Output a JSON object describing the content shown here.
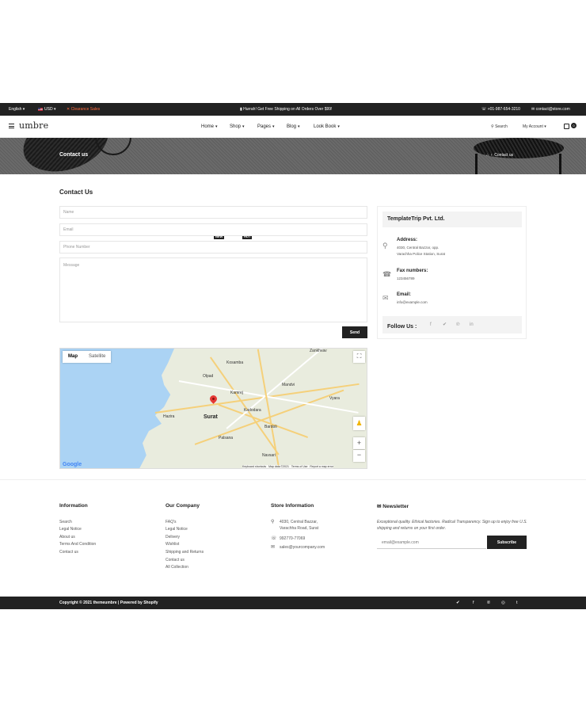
{
  "topbar": {
    "language": "English",
    "currency": "USD",
    "clearance": "Clearance Sales",
    "shipping_msg": "Hurrah! Get Free Shipping on All Orders Over $99!",
    "phone": "+01-987-654-3210",
    "email": "contact@store.com"
  },
  "header": {
    "logo": "umbre",
    "nav": [
      {
        "label": "Home",
        "badge": "NEW"
      },
      {
        "label": "Shop",
        "badge": "HOT"
      },
      {
        "label": "Pages",
        "badge": ""
      },
      {
        "label": "Blog",
        "badge": ""
      },
      {
        "label": "Look Book",
        "badge": ""
      }
    ],
    "search_label": "Search",
    "account_label": "My Account",
    "cart_count": "0"
  },
  "banner": {
    "title": "Contact us",
    "breadcrumb_current": "Contact us"
  },
  "contact_form": {
    "heading": "Contact Us",
    "name_placeholder": "Name",
    "email_placeholder": "Email",
    "phone_placeholder": "Phone Number",
    "message_placeholder": "Message",
    "send_label": "Send"
  },
  "info_card": {
    "company": "TemplateTrip Pvt. Ltd.",
    "address_label": "Address:",
    "address_line1": "4030, Central Bazzar, opp.",
    "address_line2": "Varachha Police Station, Surat",
    "fax_label": "Fax numbers:",
    "fax_value": "123456789",
    "email_label": "Email:",
    "email_value": "info@example.com",
    "follow_label": "Follow Us :"
  },
  "map": {
    "tab_map": "Map",
    "tab_satellite": "Satellite",
    "cities": [
      "Surat",
      "Hazira",
      "Kamrej",
      "Bardoli",
      "Navsari",
      "Kadodara",
      "Palsana",
      "Olpad",
      "Mandvi",
      "Vyara",
      "Zankhvav",
      "Kosamba"
    ],
    "footer_shortcuts": "Keyboard shortcuts",
    "footer_mapdata": "Map data ©2021",
    "footer_terms": "Terms of Use",
    "footer_report": "Report a map error",
    "attribution": "Google"
  },
  "footer": {
    "information": {
      "heading": "Information",
      "links": [
        "Search",
        "Legal Notice",
        "About us",
        "Terms And Condition",
        "Contact us"
      ]
    },
    "company": {
      "heading": "Our Company",
      "links": [
        "FAQ's",
        "Legal Notice",
        "Delivery",
        "Wishlist",
        "Shipping and Returns",
        "Contact us",
        "All Collection"
      ]
    },
    "store": {
      "heading": "Store Information",
      "address_line1": "4030, Central Bazzar,",
      "address_line2": "Varachha Road, Surat",
      "phone": "992770-77069",
      "email": "sales@yourcompany.com"
    },
    "newsletter": {
      "heading": "Newsletter",
      "text": "Exceptional quality. Ethical factories. Radical Transparency. Sign up to enjoy free U.S. shipping and returns on your first order.",
      "placeholder": "email@example.com",
      "button": "Subscribe"
    },
    "copyright": "Copyright © 2021 themeumbre | Powered by Shopify"
  }
}
